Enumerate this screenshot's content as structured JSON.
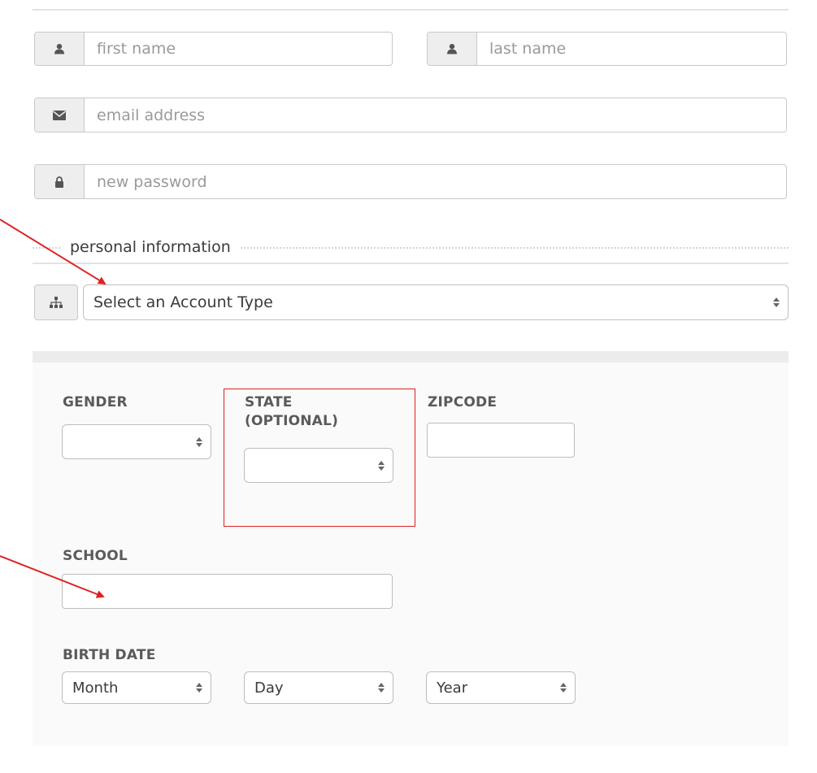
{
  "form": {
    "first_name": {
      "placeholder": "first name",
      "icon": "user-icon"
    },
    "last_name": {
      "placeholder": "last name",
      "icon": "user-icon"
    },
    "email": {
      "placeholder": "email address",
      "icon": "envelope-icon"
    },
    "password": {
      "placeholder": "new password",
      "icon": "lock-icon"
    }
  },
  "personal_section": {
    "title": "personal information",
    "account_type": {
      "selected": "Select an Account Type",
      "icon": "sitemap-icon"
    }
  },
  "details": {
    "gender_label": "GENDER",
    "state_label_line1": "STATE",
    "state_label_line2": "(OPTIONAL)",
    "zipcode_label": "ZIPCODE",
    "school_label": "SCHOOL",
    "birth_date_label": "BIRTH DATE",
    "birth_month": "Month",
    "birth_day": "Day",
    "birth_year": "Year"
  },
  "annotations": {
    "color": "#e02020"
  }
}
